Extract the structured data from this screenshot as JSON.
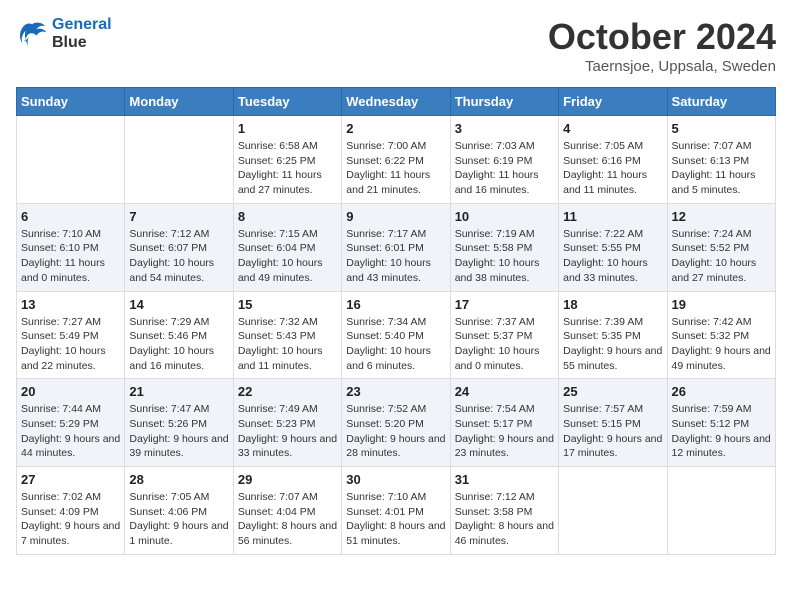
{
  "header": {
    "logo_line1": "General",
    "logo_line2": "Blue",
    "month": "October 2024",
    "location": "Taernsjoe, Uppsala, Sweden"
  },
  "weekdays": [
    "Sunday",
    "Monday",
    "Tuesday",
    "Wednesday",
    "Thursday",
    "Friday",
    "Saturday"
  ],
  "weeks": [
    [
      {
        "day": "",
        "info": ""
      },
      {
        "day": "",
        "info": ""
      },
      {
        "day": "1",
        "info": "Sunrise: 6:58 AM\nSunset: 6:25 PM\nDaylight: 11 hours and 27 minutes."
      },
      {
        "day": "2",
        "info": "Sunrise: 7:00 AM\nSunset: 6:22 PM\nDaylight: 11 hours and 21 minutes."
      },
      {
        "day": "3",
        "info": "Sunrise: 7:03 AM\nSunset: 6:19 PM\nDaylight: 11 hours and 16 minutes."
      },
      {
        "day": "4",
        "info": "Sunrise: 7:05 AM\nSunset: 6:16 PM\nDaylight: 11 hours and 11 minutes."
      },
      {
        "day": "5",
        "info": "Sunrise: 7:07 AM\nSunset: 6:13 PM\nDaylight: 11 hours and 5 minutes."
      }
    ],
    [
      {
        "day": "6",
        "info": "Sunrise: 7:10 AM\nSunset: 6:10 PM\nDaylight: 11 hours and 0 minutes."
      },
      {
        "day": "7",
        "info": "Sunrise: 7:12 AM\nSunset: 6:07 PM\nDaylight: 10 hours and 54 minutes."
      },
      {
        "day": "8",
        "info": "Sunrise: 7:15 AM\nSunset: 6:04 PM\nDaylight: 10 hours and 49 minutes."
      },
      {
        "day": "9",
        "info": "Sunrise: 7:17 AM\nSunset: 6:01 PM\nDaylight: 10 hours and 43 minutes."
      },
      {
        "day": "10",
        "info": "Sunrise: 7:19 AM\nSunset: 5:58 PM\nDaylight: 10 hours and 38 minutes."
      },
      {
        "day": "11",
        "info": "Sunrise: 7:22 AM\nSunset: 5:55 PM\nDaylight: 10 hours and 33 minutes."
      },
      {
        "day": "12",
        "info": "Sunrise: 7:24 AM\nSunset: 5:52 PM\nDaylight: 10 hours and 27 minutes."
      }
    ],
    [
      {
        "day": "13",
        "info": "Sunrise: 7:27 AM\nSunset: 5:49 PM\nDaylight: 10 hours and 22 minutes."
      },
      {
        "day": "14",
        "info": "Sunrise: 7:29 AM\nSunset: 5:46 PM\nDaylight: 10 hours and 16 minutes."
      },
      {
        "day": "15",
        "info": "Sunrise: 7:32 AM\nSunset: 5:43 PM\nDaylight: 10 hours and 11 minutes."
      },
      {
        "day": "16",
        "info": "Sunrise: 7:34 AM\nSunset: 5:40 PM\nDaylight: 10 hours and 6 minutes."
      },
      {
        "day": "17",
        "info": "Sunrise: 7:37 AM\nSunset: 5:37 PM\nDaylight: 10 hours and 0 minutes."
      },
      {
        "day": "18",
        "info": "Sunrise: 7:39 AM\nSunset: 5:35 PM\nDaylight: 9 hours and 55 minutes."
      },
      {
        "day": "19",
        "info": "Sunrise: 7:42 AM\nSunset: 5:32 PM\nDaylight: 9 hours and 49 minutes."
      }
    ],
    [
      {
        "day": "20",
        "info": "Sunrise: 7:44 AM\nSunset: 5:29 PM\nDaylight: 9 hours and 44 minutes."
      },
      {
        "day": "21",
        "info": "Sunrise: 7:47 AM\nSunset: 5:26 PM\nDaylight: 9 hours and 39 minutes."
      },
      {
        "day": "22",
        "info": "Sunrise: 7:49 AM\nSunset: 5:23 PM\nDaylight: 9 hours and 33 minutes."
      },
      {
        "day": "23",
        "info": "Sunrise: 7:52 AM\nSunset: 5:20 PM\nDaylight: 9 hours and 28 minutes."
      },
      {
        "day": "24",
        "info": "Sunrise: 7:54 AM\nSunset: 5:17 PM\nDaylight: 9 hours and 23 minutes."
      },
      {
        "day": "25",
        "info": "Sunrise: 7:57 AM\nSunset: 5:15 PM\nDaylight: 9 hours and 17 minutes."
      },
      {
        "day": "26",
        "info": "Sunrise: 7:59 AM\nSunset: 5:12 PM\nDaylight: 9 hours and 12 minutes."
      }
    ],
    [
      {
        "day": "27",
        "info": "Sunrise: 7:02 AM\nSunset: 4:09 PM\nDaylight: 9 hours and 7 minutes."
      },
      {
        "day": "28",
        "info": "Sunrise: 7:05 AM\nSunset: 4:06 PM\nDaylight: 9 hours and 1 minute."
      },
      {
        "day": "29",
        "info": "Sunrise: 7:07 AM\nSunset: 4:04 PM\nDaylight: 8 hours and 56 minutes."
      },
      {
        "day": "30",
        "info": "Sunrise: 7:10 AM\nSunset: 4:01 PM\nDaylight: 8 hours and 51 minutes."
      },
      {
        "day": "31",
        "info": "Sunrise: 7:12 AM\nSunset: 3:58 PM\nDaylight: 8 hours and 46 minutes."
      },
      {
        "day": "",
        "info": ""
      },
      {
        "day": "",
        "info": ""
      }
    ]
  ]
}
